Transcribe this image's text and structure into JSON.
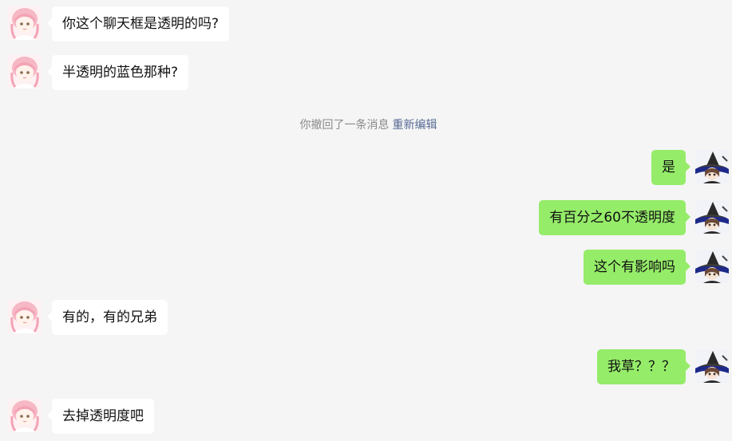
{
  "messages": [
    {
      "side": "left",
      "text": "你这个聊天框是透明的吗?"
    },
    {
      "side": "left",
      "text": "半透明的蓝色那种?"
    },
    {
      "side": "right",
      "text": "是"
    },
    {
      "side": "right",
      "text": "有百分之60不透明度"
    },
    {
      "side": "right",
      "text": "这个有影响吗"
    },
    {
      "side": "left",
      "text": "有的，有的兄弟"
    },
    {
      "side": "right",
      "text": "我草？？？"
    },
    {
      "side": "left",
      "text": "去掉透明度吧"
    }
  ],
  "system_notice": {
    "text": "你撤回了一条消息",
    "action_label": "重新编辑"
  },
  "colors": {
    "background": "#f5f5f5",
    "incoming_bubble": "#ffffff",
    "outgoing_bubble": "#95ec69",
    "system_text": "#8a8a8a",
    "link": "#576b95"
  },
  "icons": {
    "incoming_avatar": "pink-hair-girl-avatar",
    "outgoing_avatar": "witch-hat-girl-avatar"
  }
}
